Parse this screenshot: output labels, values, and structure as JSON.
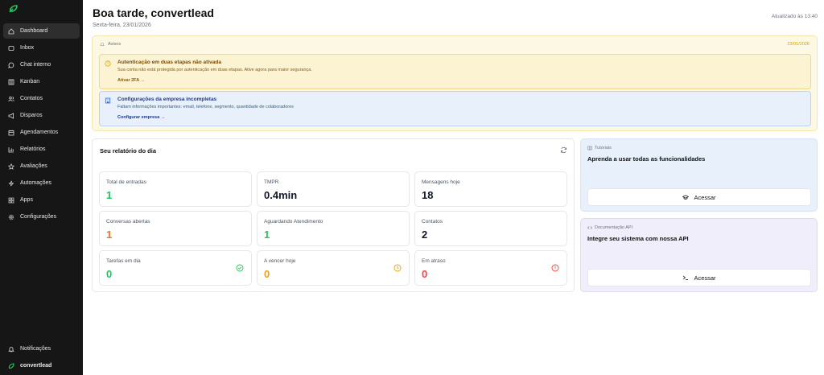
{
  "header": {
    "greeting": "Boa tarde, convertlead",
    "date": "Sexta-feira, 23/01/2026",
    "updated": "Atualizado às 13:40"
  },
  "sidebar": {
    "items": [
      {
        "label": "Dashboard",
        "icon": "home-icon",
        "active": true
      },
      {
        "label": "Inbox",
        "icon": "inbox-icon"
      },
      {
        "label": "Chat interno",
        "icon": "chat-icon"
      },
      {
        "label": "Kanban",
        "icon": "kanban-icon"
      },
      {
        "label": "Contatos",
        "icon": "users-icon"
      },
      {
        "label": "Disparos",
        "icon": "megaphone-icon"
      },
      {
        "label": "Agendamentos",
        "icon": "calendar-icon"
      },
      {
        "label": "Relatórios",
        "icon": "bar-chart-icon"
      },
      {
        "label": "Avaliações",
        "icon": "star-icon"
      },
      {
        "label": "Automações",
        "icon": "zap-icon"
      },
      {
        "label": "Apps",
        "icon": "grid-icon"
      },
      {
        "label": "Configurações",
        "icon": "gear-icon"
      }
    ],
    "bottom": {
      "notifications": "Notificações",
      "brand": "convertlead"
    }
  },
  "notices": {
    "heading": "Avisos",
    "date": "23/01/2026",
    "warning": {
      "title": "Autenticação em duas etapas não ativada",
      "description": "Sua conta não está protegida por autenticação em duas etapas. Ative agora para maior segurança.",
      "link": "Ativar 2FA",
      "color": "#fcf3d3"
    },
    "info": {
      "title": "Configurações da empresa incompletas",
      "description": "Faltam informações importantes: email, telefone, segmento, quantidade de colaboradores",
      "link": "Configurar empresa",
      "color": "#e8f1fb"
    }
  },
  "report": {
    "title": "Seu relatório do dia",
    "stats": [
      {
        "label": "Total de entradas",
        "value": "1",
        "color": "#22c55e"
      },
      {
        "label": "TMPR",
        "value": "0.4min",
        "color": "#111827"
      },
      {
        "label": "Mensagens hoje",
        "value": "18",
        "color": "#111827"
      },
      {
        "label": "Conversas abertas",
        "value": "1",
        "color": "#f97316"
      },
      {
        "label": "Aguardando Atendimento",
        "value": "1",
        "color": "#22c55e"
      },
      {
        "label": "Contatos",
        "value": "2",
        "color": "#111827"
      },
      {
        "label": "Tarefas em dia",
        "value": "0",
        "color": "#22c55e",
        "icon": "check-circle-icon"
      },
      {
        "label": "A vencer hoje",
        "value": "0",
        "color": "#f59e0b",
        "icon": "clock-icon"
      },
      {
        "label": "Em atraso",
        "value": "0",
        "color": "#ef4444",
        "icon": "alert-circle-icon"
      }
    ]
  },
  "tutorials": {
    "tag": "Tutoriais",
    "title": "Aprenda a usar todas as funcionalidades",
    "button": "Acessar"
  },
  "api": {
    "tag": "Documentação API",
    "title": "Integre seu sistema com nossa API",
    "button": "Acessar"
  }
}
